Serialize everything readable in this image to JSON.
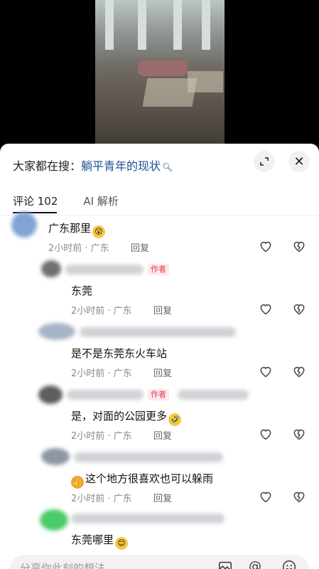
{
  "header": {
    "search_prefix": "大家都在搜：",
    "search_query": "躺平青年的现状",
    "search_icon": "search-icon",
    "expand_icon": "expand-icon",
    "close_icon": "close-icon"
  },
  "tabs": [
    {
      "label": "评论 102",
      "active": true
    },
    {
      "label": "AI 解析",
      "active": false
    }
  ],
  "comments": [
    {
      "text": "广东那里",
      "time": "2小时前 · 广东",
      "reply": "回复",
      "author": false,
      "emoji": "😲"
    },
    {
      "text": "东莞",
      "time": "2小时前 · 广东",
      "reply": "回复",
      "author": true,
      "author_label": "作者"
    },
    {
      "text": "是不是东莞东火车站",
      "time": "2小时前 · 广东",
      "reply": "回复",
      "author": false
    },
    {
      "text": "是，对面的公园更多",
      "time": "2小时前 · 广东",
      "reply": "回复",
      "author": true,
      "author_label": "作者",
      "emoji": "🤣"
    },
    {
      "text": "这个地方很喜欢也可以躲雨",
      "time": "2小时前 · 广东",
      "reply": "回复",
      "author": false,
      "lead_emoji": "👍"
    },
    {
      "text": "东莞哪里",
      "author": false,
      "emoji": "😊"
    }
  ],
  "input": {
    "placeholder": "分享你此刻的想法"
  },
  "colors": {
    "link": "#1d4f8f",
    "author_tag": "#e8334c"
  }
}
